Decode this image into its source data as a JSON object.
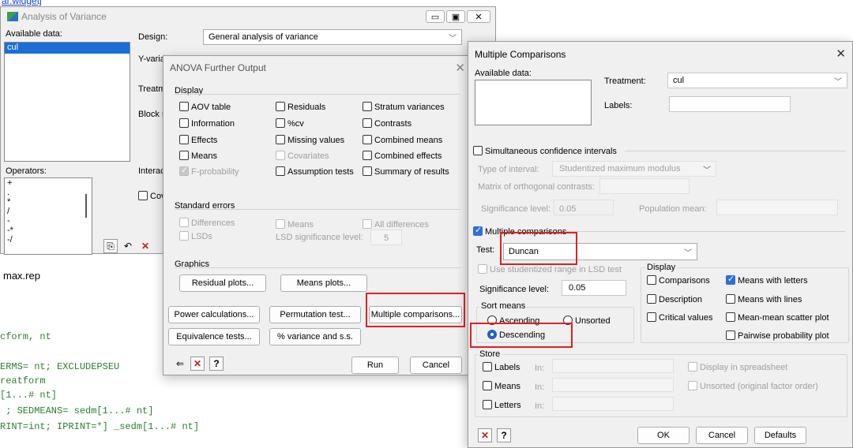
{
  "top_link": "ar.widgetj",
  "editor": {
    "lines": [
      "max.rep",
      "cform, nt",
      "ERMS= nt; EXCLUDEPSEU",
      "reatform",
      "[1...# nt]",
      " ; SEDMEANS= sedm[1...# nt]",
      "RINT=int; IPRINT=*] _sedm[1...# nt]"
    ]
  },
  "anova": {
    "title": "Analysis of Variance",
    "available_data_label": "Available data:",
    "available_items": [
      "cul"
    ],
    "design_label": "Design:",
    "design_value": "General analysis of variance",
    "yvariate_label": "Y-variat",
    "treatment_label": "Treatm",
    "block_label": "Block s",
    "interactions_label": "Interact",
    "covariates_label": "Cov",
    "operators_label": "Operators:",
    "operators": [
      "+",
      ".",
      "*",
      "/",
      "-",
      "-*",
      "-/"
    ]
  },
  "further": {
    "title": "ANOVA Further Output",
    "display_title": "Display",
    "display": [
      {
        "label": "AOV table",
        "checked": false,
        "enabled": true
      },
      {
        "label": "Residuals",
        "checked": false,
        "enabled": true
      },
      {
        "label": "Stratum variances",
        "checked": false,
        "enabled": true
      },
      {
        "label": "Information",
        "checked": false,
        "enabled": true
      },
      {
        "label": "%cv",
        "checked": false,
        "enabled": true
      },
      {
        "label": "Contrasts",
        "checked": false,
        "enabled": true
      },
      {
        "label": "Effects",
        "checked": false,
        "enabled": true
      },
      {
        "label": "Missing values",
        "checked": false,
        "enabled": true
      },
      {
        "label": "Combined means",
        "checked": false,
        "enabled": true
      },
      {
        "label": "Means",
        "checked": false,
        "enabled": true
      },
      {
        "label": "Covariates",
        "checked": false,
        "enabled": false
      },
      {
        "label": "Combined effects",
        "checked": false,
        "enabled": true
      },
      {
        "label": "F-probability",
        "checked": true,
        "enabled": false
      },
      {
        "label": "Assumption tests",
        "checked": false,
        "enabled": true
      },
      {
        "label": "Summary of results",
        "checked": false,
        "enabled": true
      }
    ],
    "se_title": "Standard errors",
    "se_differences": "Differences",
    "se_means": "Means",
    "se_all_differences": "All differences",
    "se_lsds": "LSDs",
    "lsd_level_label": "LSD significance level:",
    "lsd_level_value": "5",
    "graphics_title": "Graphics",
    "residual_plots": "Residual plots...",
    "means_plots": "Means plots...",
    "power_calc": "Power calculations...",
    "permutation": "Permutation test...",
    "multiple_comparisons": "Multiple comparisons...",
    "equivalence": "Equivalence tests...",
    "variance_ss": "% variance and s.s.",
    "run": "Run",
    "cancel": "Cancel"
  },
  "mc": {
    "title": "Multiple Comparisons",
    "available_data_label": "Available data:",
    "treatment_label": "Treatment:",
    "treatment_value": "cul",
    "labels_label": "Labels:",
    "sim_ci": "Simultaneous confidence intervals",
    "type_interval_label": "Type of interval:",
    "type_interval_value": "Studentized maximum modulus",
    "matrix_label": "Matrix of orthogonal contrasts:",
    "sig_level_label_dis": "Significance level:",
    "sig_level_value_dis": "0.05",
    "pop_mean_label": "Population mean:",
    "multiple_comparisons": "Multiple comparisons",
    "test_label": "Test:",
    "test_value": "Duncan",
    "studentized_lsd": "Use studentized range in LSD test",
    "sig_level_label": "Significance level:",
    "sig_level_value": "0.05",
    "sort_means_title": "Sort means",
    "ascending": "Ascending",
    "unsorted": "Unsorted",
    "descending": "Descending",
    "display_title": "Display",
    "comparisons": "Comparisons",
    "means_letters": "Means with letters",
    "description": "Description",
    "means_lines": "Means with lines",
    "critical_values": "Critical values",
    "mean_scatter": "Mean-mean scatter plot",
    "pairwise_plot": "Pairwise probability plot",
    "store_title": "Store",
    "store_labels": "Labels",
    "store_means": "Means",
    "store_letters": "Letters",
    "in_label": "In:",
    "display_spreadsheet": "Display in spreadsheet",
    "unsorted_original": "Unsorted (original factor order)",
    "ok": "OK",
    "cancel": "Cancel",
    "defaults": "Defaults"
  }
}
